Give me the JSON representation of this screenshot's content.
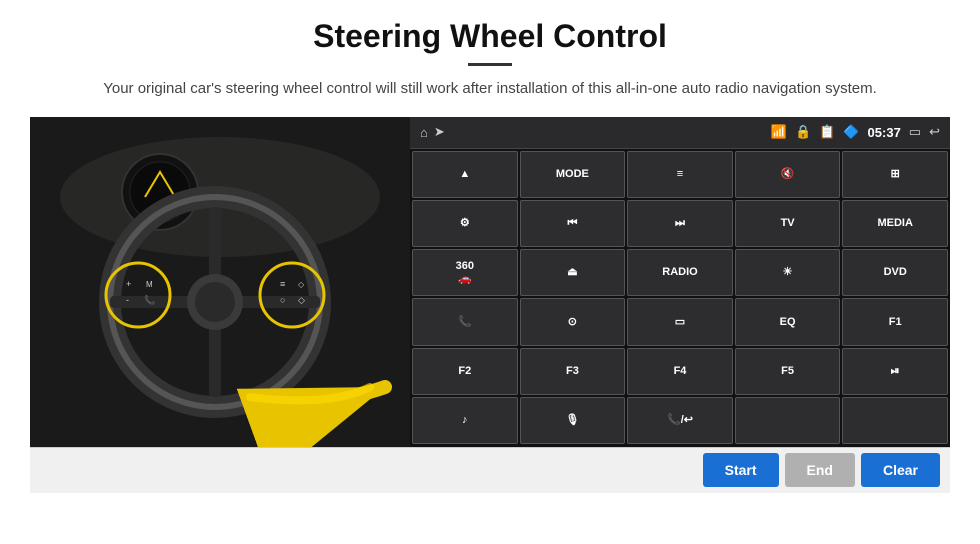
{
  "header": {
    "title": "Steering Wheel Control",
    "subtitle": "Your original car's steering wheel control will still work after installation of this all-in-one auto radio navigation system."
  },
  "status_bar": {
    "time": "05:37",
    "icons": [
      "home",
      "wifi",
      "lock",
      "sim",
      "bluetooth",
      "screen",
      "back"
    ]
  },
  "buttons": [
    {
      "id": "b1",
      "label": "▲",
      "type": "icon"
    },
    {
      "id": "b2",
      "label": "MODE",
      "type": "text"
    },
    {
      "id": "b3",
      "label": "≡",
      "type": "icon"
    },
    {
      "id": "b4",
      "label": "🔇",
      "type": "icon"
    },
    {
      "id": "b5",
      "label": "⊞",
      "type": "icon"
    },
    {
      "id": "b6",
      "label": "⚙",
      "type": "icon"
    },
    {
      "id": "b7",
      "label": "⏮",
      "type": "icon"
    },
    {
      "id": "b8",
      "label": "⏭",
      "type": "icon"
    },
    {
      "id": "b9",
      "label": "TV",
      "type": "text"
    },
    {
      "id": "b10",
      "label": "MEDIA",
      "type": "text"
    },
    {
      "id": "b11",
      "label": "360",
      "type": "text"
    },
    {
      "id": "b12",
      "label": "⏏",
      "type": "icon"
    },
    {
      "id": "b13",
      "label": "RADIO",
      "type": "text"
    },
    {
      "id": "b14",
      "label": "☀",
      "type": "icon"
    },
    {
      "id": "b15",
      "label": "DVD",
      "type": "text"
    },
    {
      "id": "b16",
      "label": "📞",
      "type": "icon"
    },
    {
      "id": "b17",
      "label": "◎",
      "type": "icon"
    },
    {
      "id": "b18",
      "label": "▭",
      "type": "icon"
    },
    {
      "id": "b19",
      "label": "EQ",
      "type": "text"
    },
    {
      "id": "b20",
      "label": "F1",
      "type": "text"
    },
    {
      "id": "b21",
      "label": "F2",
      "type": "text"
    },
    {
      "id": "b22",
      "label": "F3",
      "type": "text"
    },
    {
      "id": "b23",
      "label": "F4",
      "type": "text"
    },
    {
      "id": "b24",
      "label": "F5",
      "type": "text"
    },
    {
      "id": "b25",
      "label": "⏯",
      "type": "icon"
    },
    {
      "id": "b26",
      "label": "♪",
      "type": "icon"
    },
    {
      "id": "b27",
      "label": "🎙",
      "type": "icon"
    },
    {
      "id": "b28",
      "label": "📞/↩",
      "type": "icon"
    },
    {
      "id": "b29",
      "label": "",
      "type": "empty"
    },
    {
      "id": "b30",
      "label": "",
      "type": "empty"
    }
  ],
  "action_bar": {
    "start_label": "Start",
    "end_label": "End",
    "clear_label": "Clear"
  }
}
